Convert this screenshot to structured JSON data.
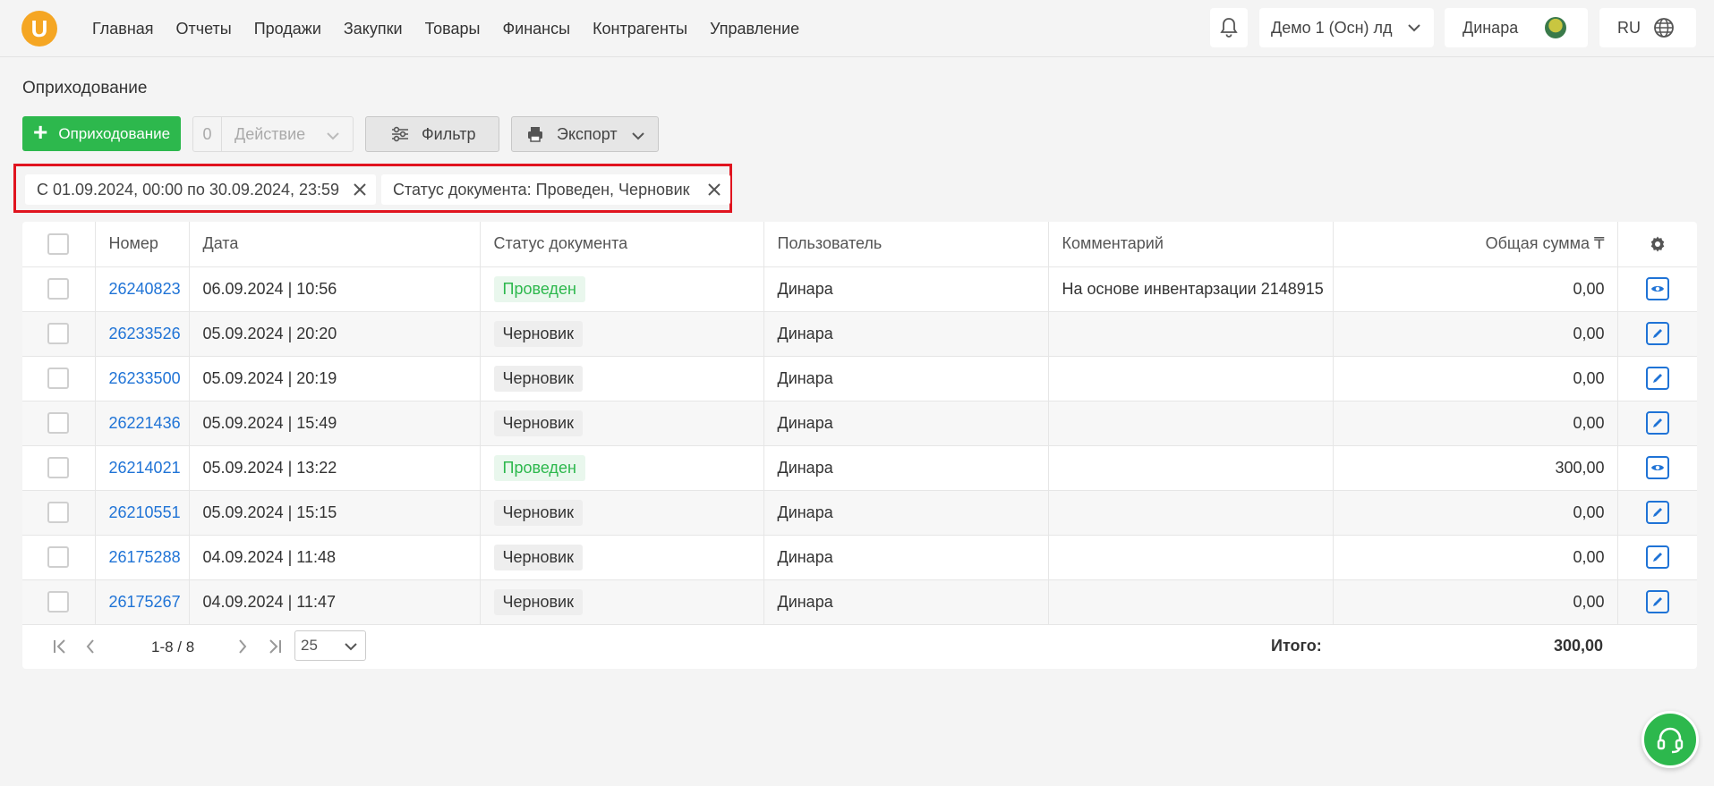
{
  "app": {
    "logo_letter": "U"
  },
  "nav": [
    "Главная",
    "Отчеты",
    "Продажи",
    "Закупки",
    "Товары",
    "Финансы",
    "Контрагенты",
    "Управление"
  ],
  "header": {
    "org": "Демо 1 (Осн) лд",
    "user": "Динара",
    "lang": "RU"
  },
  "page": {
    "title": "Оприходование"
  },
  "toolbar": {
    "add_label": "Оприходование",
    "action_count": "0",
    "action_label": "Действие",
    "filter_label": "Фильтр",
    "export_label": "Экспорт"
  },
  "filters": [
    "С 01.09.2024, 00:00 по 30.09.2024, 23:59",
    "Статус документа: Проведен, Черновик"
  ],
  "table": {
    "columns": [
      "Номер",
      "Дата",
      "Статус документа",
      "Пользователь",
      "Комментарий",
      "Общая сумма ₸"
    ],
    "rows": [
      {
        "number": "26240823",
        "date": "06.09.2024 | 10:56",
        "status": "Проведен",
        "user": "Динара",
        "comment": "На основе инвентарзации 2148915",
        "sum": "0,00",
        "action": "view"
      },
      {
        "number": "26233526",
        "date": "05.09.2024 | 20:20",
        "status": "Черновик",
        "user": "Динара",
        "comment": "",
        "sum": "0,00",
        "action": "edit"
      },
      {
        "number": "26233500",
        "date": "05.09.2024 | 20:19",
        "status": "Черновик",
        "user": "Динара",
        "comment": "",
        "sum": "0,00",
        "action": "edit"
      },
      {
        "number": "26221436",
        "date": "05.09.2024 | 15:49",
        "status": "Черновик",
        "user": "Динара",
        "comment": "",
        "sum": "0,00",
        "action": "edit"
      },
      {
        "number": "26214021",
        "date": "05.09.2024 | 13:22",
        "status": "Проведен",
        "user": "Динара",
        "comment": "",
        "sum": "300,00",
        "action": "view"
      },
      {
        "number": "26210551",
        "date": "05.09.2024 | 15:15",
        "status": "Черновик",
        "user": "Динара",
        "comment": "",
        "sum": "0,00",
        "action": "edit"
      },
      {
        "number": "26175288",
        "date": "04.09.2024 | 11:48",
        "status": "Черновик",
        "user": "Динара",
        "comment": "",
        "sum": "0,00",
        "action": "edit"
      },
      {
        "number": "26175267",
        "date": "04.09.2024 | 11:47",
        "status": "Черновик",
        "user": "Динара",
        "comment": "",
        "sum": "0,00",
        "action": "edit"
      }
    ]
  },
  "pagination": {
    "range": "1-8 / 8",
    "page_size": "25"
  },
  "totals": {
    "label": "Итого:",
    "value": "300,00"
  },
  "colors": {
    "accent_green": "#2db84d",
    "link_blue": "#1f73d6",
    "highlight_red": "#e0141f",
    "logo_orange": "#f5a623"
  }
}
